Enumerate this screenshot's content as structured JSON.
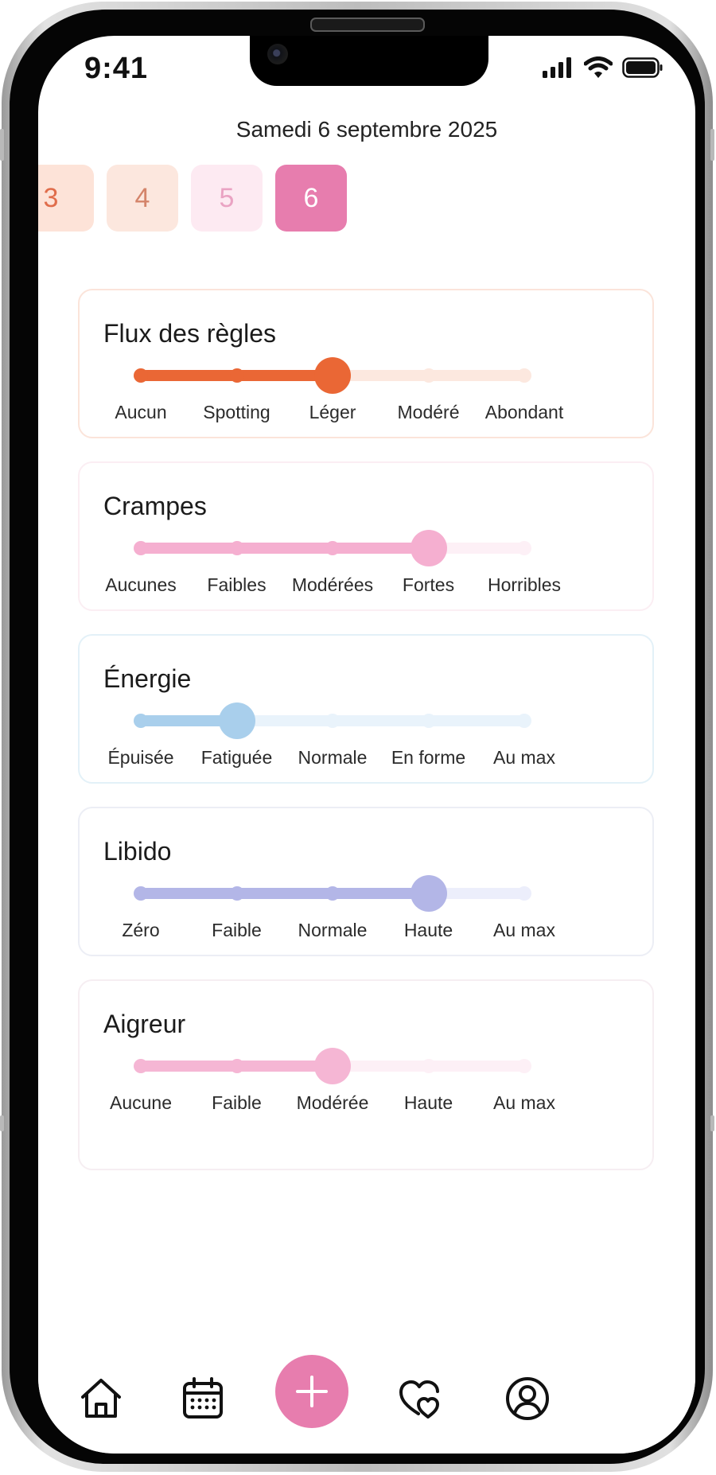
{
  "status_bar": {
    "time": "9:41"
  },
  "date": "Samedi 6 septembre 2025",
  "days": [
    {
      "label": "3",
      "bg": "#fde3d8",
      "fg": "#e06d4b"
    },
    {
      "label": "4",
      "bg": "#fce7de",
      "fg": "#d4846a"
    },
    {
      "label": "5",
      "bg": "#fdeaf2",
      "fg": "#eaa3c3"
    },
    {
      "label": "6",
      "bg": "#e77dae",
      "fg": "#ffffff",
      "selected": true
    }
  ],
  "trackers": [
    {
      "title": "Flux des règles",
      "options": [
        "Aucun",
        "Spotting",
        "Léger",
        "Modéré",
        "Abondant"
      ],
      "selected_index": 2,
      "color": "#ea6735",
      "light": "#fce8df",
      "border": "#fbe4da"
    },
    {
      "title": "Crampes",
      "options": [
        "Aucunes",
        "Faibles",
        "Modérées",
        "Fortes",
        "Horribles"
      ],
      "selected_index": 3,
      "color": "#f5afd0",
      "light": "#fdf0f6",
      "border": "#fbeef3"
    },
    {
      "title": "Énergie",
      "options": [
        "Épuisée",
        "Fatiguée",
        "Normale",
        "En forme",
        "Au max"
      ],
      "selected_index": 1,
      "color": "#a9cfec",
      "light": "#e9f3fb",
      "border": "#e3f1f8"
    },
    {
      "title": "Libido",
      "options": [
        "Zéro",
        "Faible",
        "Normale",
        "Haute",
        "Au max"
      ],
      "selected_index": 3,
      "color": "#b3b6e7",
      "light": "#eceefb",
      "border": "#eceef5"
    },
    {
      "title": "Aigreur",
      "options": [
        "Aucune",
        "Faible",
        "Modérée",
        "Haute",
        "Au max"
      ],
      "selected_index": 2,
      "color": "#f5b6d4",
      "light": "#fdf0f6",
      "border": "#f6eef2"
    }
  ],
  "nav": {
    "items": [
      "home-icon",
      "calendar-icon",
      "plus-icon",
      "hearts-icon",
      "profile-icon"
    ],
    "fab_color": "#e77dae"
  }
}
